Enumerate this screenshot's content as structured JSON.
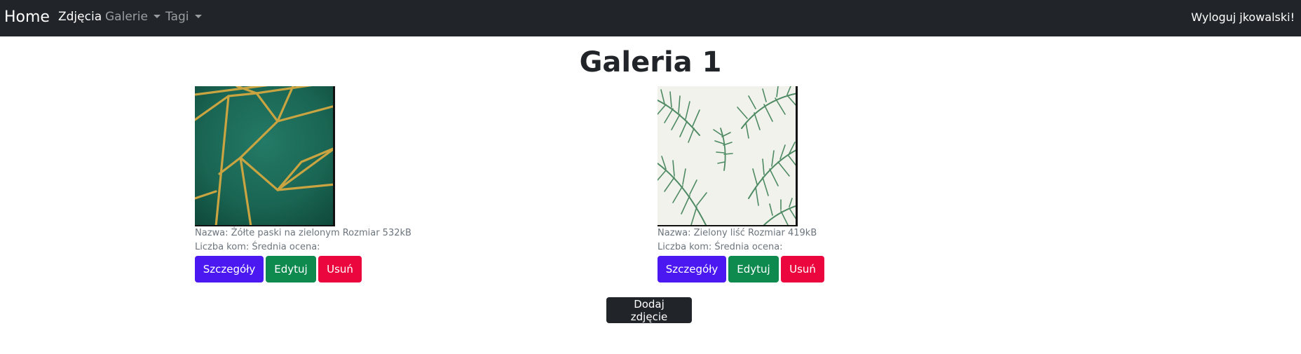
{
  "nav": {
    "brand": "Home",
    "links": [
      {
        "label": "Zdjęcia",
        "active": true
      },
      {
        "label": "Galerie",
        "dropdown": true
      },
      {
        "label": "Tagi",
        "dropdown": true
      }
    ],
    "logout": "Wyloguj jkowalski!"
  },
  "gallery": {
    "title": "Galeria 1",
    "photos": [
      {
        "info": "Nazwa: Żółte paski na zielonym Rozmiar 532kB",
        "stats": "Liczba kom: Średnia ocena:",
        "image_icon": "green-gold-geometric-pattern-image"
      },
      {
        "info": "Nazwa: Zielony liść Rozmiar 419kB",
        "stats": "Liczba kom: Średnia ocena:",
        "image_icon": "green-palm-leaves-image"
      }
    ],
    "buttons": {
      "details": "Szczegóły",
      "edit": "Edytuj",
      "delete": "Usuń"
    },
    "add_button": "Dodaj zdjęcie"
  },
  "colors": {
    "navbar": "#212529",
    "primary": "#4b18f2",
    "success": "#0e8a4f",
    "danger": "#ec063e",
    "dark": "#212529"
  }
}
